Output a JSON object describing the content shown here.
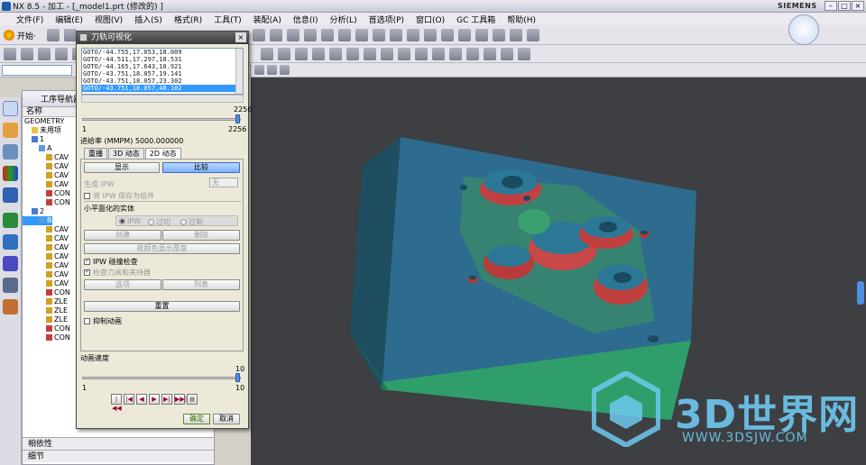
{
  "window": {
    "title": "NX 8.5 - 加工 - [_model1.prt  (修改的) ]",
    "brand": "SIEMENS",
    "controls": [
      "–",
      "□",
      "×"
    ]
  },
  "menu": [
    "文件(F)",
    "编辑(E)",
    "视图(V)",
    "插入(S)",
    "格式(R)",
    "工具(T)",
    "装配(A)",
    "信息(I)",
    "分析(L)",
    "首选项(P)",
    "窗口(O)",
    "GC 工具箱",
    "帮助(H)"
  ],
  "toolbar": {
    "start_label": "开始·"
  },
  "navigator": {
    "title": "工序导航器",
    "column": "名称",
    "items": [
      {
        "label": "GEOMETRY",
        "indent": 0,
        "icon": "none"
      },
      {
        "label": "未用项",
        "indent": 1,
        "icon": "folder"
      },
      {
        "label": "1",
        "indent": 1,
        "icon": "coord"
      },
      {
        "label": "A",
        "indent": 2,
        "icon": "geom"
      },
      {
        "label": "CAV",
        "indent": 3,
        "icon": "op"
      },
      {
        "label": "CAV",
        "indent": 3,
        "icon": "op"
      },
      {
        "label": "CAV",
        "indent": 3,
        "icon": "op"
      },
      {
        "label": "CAV",
        "indent": 3,
        "icon": "op"
      },
      {
        "label": "CON",
        "indent": 3,
        "icon": "op2"
      },
      {
        "label": "CON",
        "indent": 3,
        "icon": "op2"
      },
      {
        "label": "2",
        "indent": 1,
        "icon": "coord"
      },
      {
        "label": "B",
        "indent": 2,
        "icon": "geom",
        "selected": true
      },
      {
        "label": "CAV",
        "indent": 3,
        "icon": "op"
      },
      {
        "label": "CAV",
        "indent": 3,
        "icon": "op"
      },
      {
        "label": "CAV",
        "indent": 3,
        "icon": "op"
      },
      {
        "label": "CAV",
        "indent": 3,
        "icon": "op"
      },
      {
        "label": "CAV",
        "indent": 3,
        "icon": "op"
      },
      {
        "label": "CAV",
        "indent": 3,
        "icon": "op"
      },
      {
        "label": "CAV",
        "indent": 3,
        "icon": "op"
      },
      {
        "label": "CON",
        "indent": 3,
        "icon": "op2"
      },
      {
        "label": "ZLE",
        "indent": 3,
        "icon": "op"
      },
      {
        "label": "ZLE",
        "indent": 3,
        "icon": "op"
      },
      {
        "label": "ZLE",
        "indent": 3,
        "icon": "op"
      },
      {
        "label": "CON",
        "indent": 3,
        "icon": "op2"
      },
      {
        "label": "CON",
        "indent": 3,
        "icon": "op2"
      }
    ],
    "bottom": [
      "相依性",
      "细节"
    ]
  },
  "dialog": {
    "title": "刀轨可视化",
    "gotos": [
      "GOTO/-44.755,17.053,18.009",
      "GOTO/-44.511,17.297,18.531",
      "GOTO/-44.165,17.643,18.921",
      "GOTO/-43.751,18.057,19.141",
      "GOTO/-43.751,18.057,23.302",
      "GOTO/-43.751,18.057,48.102"
    ],
    "slider_max": "2256",
    "slider_min": "1",
    "slider_value": "2256",
    "feed_rate": "进给率 (MMPM) 5000.000000",
    "tabs": [
      "重播",
      "3D 动态",
      "2D 动态"
    ],
    "active_tab": "2D 动态",
    "show_btn": "显示",
    "compare_btn": "比较",
    "gen_ipw": "生成 IPW",
    "gen_ipw_value": "无",
    "save_ipw": "将 IPW 保存为组件",
    "faceted_group": "小平面化的实体",
    "radio_ipw": "IPW",
    "radio_cut": "过切",
    "radio_over": "过剩",
    "create_btn": "创建",
    "delete_btn": "删除",
    "color_btn": "按颜色显示厚度",
    "collision_check": "IPW 碰撞检查",
    "check_tools": "检查刀具和夹持器",
    "options_btn": "选项",
    "list_btn": "列表",
    "reset_btn": "重置",
    "suppress_anim": "抑制动画",
    "anim_speed": "动画速度",
    "speed_min": "1",
    "speed_max": "10",
    "speed_value": "10",
    "ok": "确定",
    "cancel": "取消"
  },
  "watermark": {
    "main": "3D世界网",
    "url": "WWW.3DSJW.COM"
  }
}
